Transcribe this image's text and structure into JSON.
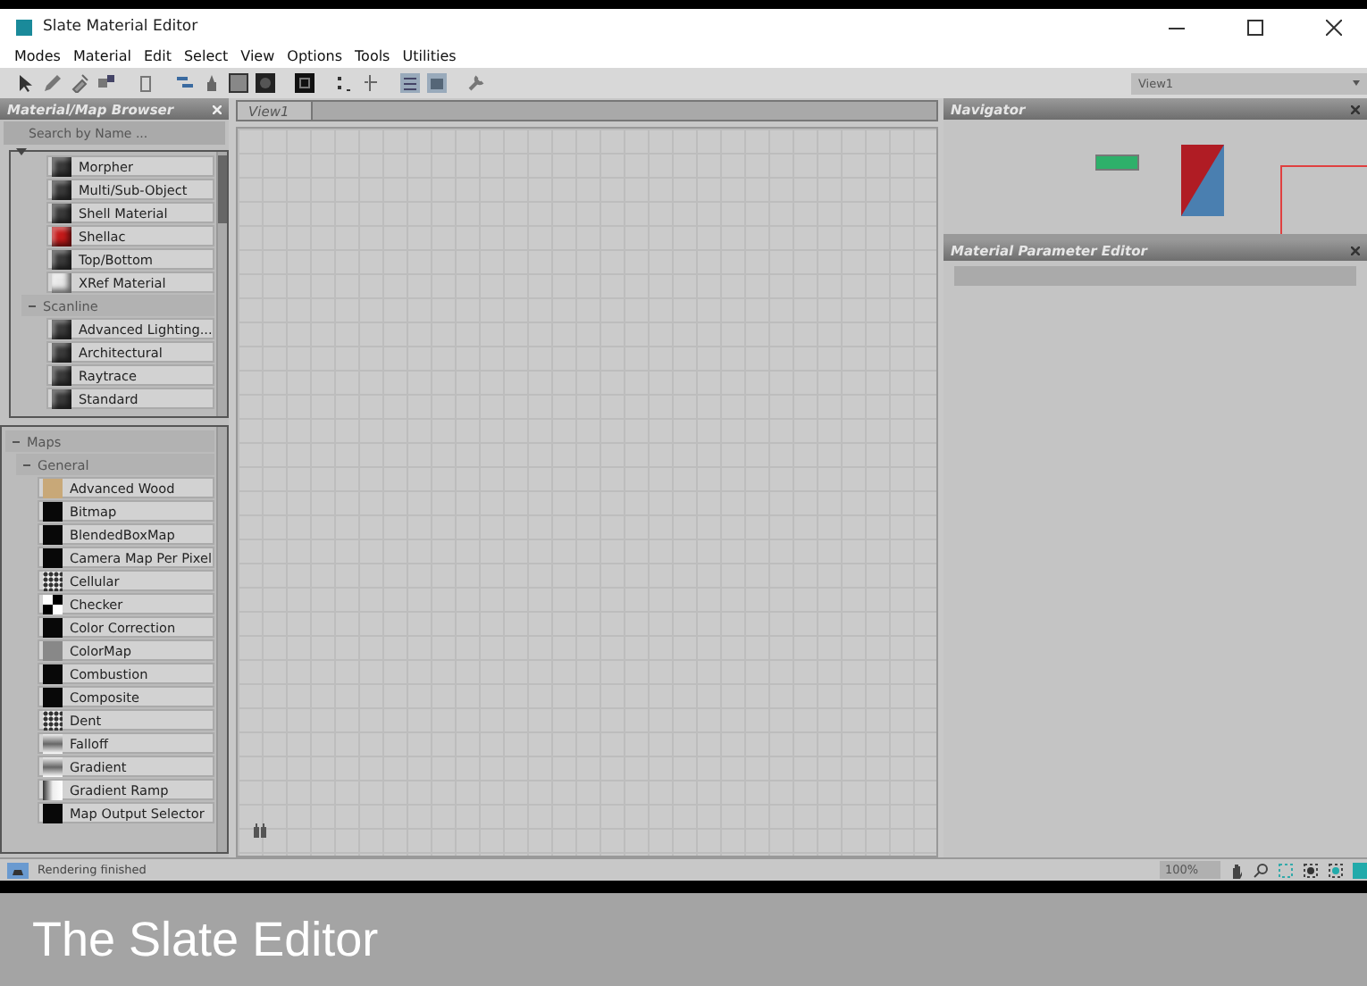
{
  "window": {
    "title": "Slate Material Editor"
  },
  "menu": [
    "Modes",
    "Material",
    "Edit",
    "Select",
    "View",
    "Options",
    "Tools",
    "Utilities"
  ],
  "view_selector": {
    "value": "View1"
  },
  "browser": {
    "title": "Material/Map Browser",
    "search": {
      "placeholder": "Search by Name ..."
    },
    "materials": {
      "items": [
        {
          "label": "Morpher",
          "kind": "sphere",
          "color": "#3a3a3a"
        },
        {
          "label": "Multi/Sub-Object",
          "kind": "sphere",
          "color": "#3a3a3a"
        },
        {
          "label": "Shell Material",
          "kind": "sphere",
          "color": "#3a3a3a"
        },
        {
          "label": "Shellac",
          "kind": "sphere",
          "color": "#c41a1a"
        },
        {
          "label": "Top/Bottom",
          "kind": "sphere",
          "color": "#3a3a3a"
        },
        {
          "label": "XRef Material",
          "kind": "sphere",
          "color": "#e8e8e8"
        }
      ],
      "children": [
        {
          "label": "Scanline",
          "expanded": true,
          "items": [
            {
              "label": "Advanced Lighting...",
              "kind": "sphere",
              "color": "#3a3a3a"
            },
            {
              "label": "Architectural",
              "kind": "sphere",
              "color": "#3a3a3a"
            },
            {
              "label": "Raytrace",
              "kind": "sphere",
              "color": "#3a3a3a"
            },
            {
              "label": "Standard",
              "kind": "sphere",
              "color": "#3a3a3a"
            }
          ]
        }
      ]
    },
    "maps": {
      "label": "Maps",
      "expanded": true,
      "children": [
        {
          "label": "General",
          "expanded": true,
          "items": [
            {
              "label": "Advanced Wood",
              "kind": "flat",
              "color": "#c8a878"
            },
            {
              "label": "Bitmap",
              "kind": "flat",
              "color": "#080808"
            },
            {
              "label": "BlendedBoxMap",
              "kind": "flat",
              "color": "#080808"
            },
            {
              "label": "Camera Map Per Pixel",
              "kind": "flat",
              "color": "#080808"
            },
            {
              "label": "Cellular",
              "kind": "noise"
            },
            {
              "label": "Checker",
              "kind": "checker"
            },
            {
              "label": "Color Correction",
              "kind": "flat",
              "color": "#080808"
            },
            {
              "label": "ColorMap",
              "kind": "flat",
              "color": "#888888"
            },
            {
              "label": "Combustion",
              "kind": "flat",
              "color": "#080808"
            },
            {
              "label": "Composite",
              "kind": "flat",
              "color": "#080808"
            },
            {
              "label": "Dent",
              "kind": "noise"
            },
            {
              "label": "Falloff",
              "kind": "gradient"
            },
            {
              "label": "Gradient",
              "kind": "gradient"
            },
            {
              "label": "Gradient Ramp",
              "kind": "ramp"
            },
            {
              "label": "Map Output Selector",
              "kind": "flat",
              "color": "#080808"
            }
          ]
        }
      ]
    }
  },
  "view": {
    "tab": "View1"
  },
  "navigator": {
    "title": "Navigator"
  },
  "parameter_editor": {
    "title": "Material Parameter Editor"
  },
  "status_bar": {
    "text": "Rendering finished",
    "zoom": "100%"
  },
  "caption": "The Slate Editor"
}
